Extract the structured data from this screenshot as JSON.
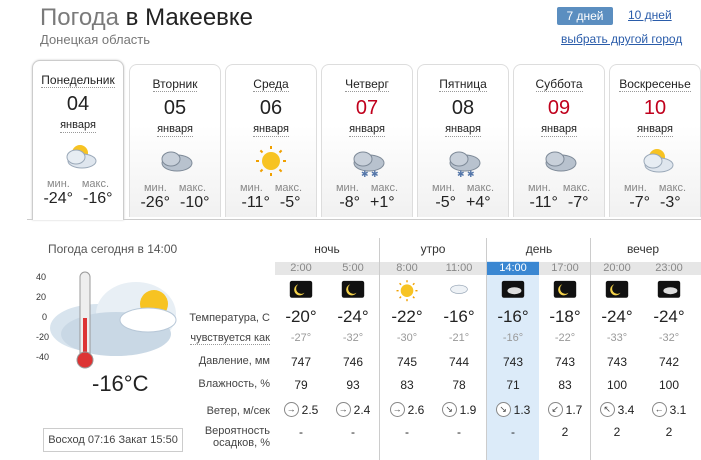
{
  "header": {
    "title_prefix": "Погода",
    "title_city": "в Макеевке",
    "region": "Донецкая область",
    "toggle_7": "7 дней",
    "toggle_10": "10 дней",
    "other_city": "выбрать другой город"
  },
  "days": [
    {
      "name": "Понедельник",
      "num": "04",
      "month": "января",
      "min": "-24°",
      "max": "-16°",
      "icon": "partly-cloudy-sun-icon",
      "holiday": false
    },
    {
      "name": "Вторник",
      "num": "05",
      "month": "января",
      "min": "-26°",
      "max": "-10°",
      "icon": "cloudy-icon",
      "holiday": false
    },
    {
      "name": "Среда",
      "num": "06",
      "month": "января",
      "min": "-11°",
      "max": "-5°",
      "icon": "sun-icon",
      "holiday": false
    },
    {
      "name": "Четверг",
      "num": "07",
      "month": "января",
      "min": "-8°",
      "max": "+1°",
      "icon": "snow-cloud-icon",
      "holiday": true
    },
    {
      "name": "Пятница",
      "num": "08",
      "month": "января",
      "min": "-5°",
      "max": "+4°",
      "icon": "snow-cloud-icon",
      "holiday": false
    },
    {
      "name": "Суббота",
      "num": "09",
      "month": "января",
      "min": "-11°",
      "max": "-7°",
      "icon": "cloudy-icon",
      "holiday": true
    },
    {
      "name": "Воскресенье",
      "num": "10",
      "month": "января",
      "min": "-7°",
      "max": "-3°",
      "icon": "partly-cloudy-sun-icon",
      "holiday": true
    }
  ],
  "day_labels": {
    "min": "мин.",
    "max": "макс."
  },
  "today": {
    "title": "Погода сегодня в 14:00",
    "temp": "-16°C",
    "scale": [
      "40",
      "20",
      "0",
      "-20",
      "-40"
    ],
    "sunrise_label": "Восход",
    "sunrise": "07:16",
    "sunset_label": "Закат",
    "sunset": "15:50"
  },
  "periods": [
    "ночь",
    "утро",
    "день",
    "вечер"
  ],
  "hours": [
    "2:00",
    "5:00",
    "8:00",
    "11:00",
    "14:00",
    "17:00",
    "20:00",
    "23:00"
  ],
  "hour_icons": [
    "moon-icon",
    "moon-icon",
    "sun-icon",
    "cloud-icon",
    "cloud-moon-icon",
    "moon-icon",
    "moon-icon",
    "cloud-moon-icon"
  ],
  "row_labels": {
    "temp": "Температура, С",
    "feel": "чувствуется как",
    "pressure": "Давление, мм",
    "humidity": "Влажность, %",
    "wind": "Ветер, м/сек",
    "precip1": "Вероятность",
    "precip2": "осадков, %"
  },
  "temp": [
    "-20°",
    "-24°",
    "-22°",
    "-16°",
    "-16°",
    "-18°",
    "-24°",
    "-24°"
  ],
  "feel": [
    "-27°",
    "-32°",
    "-30°",
    "-21°",
    "-16°",
    "-22°",
    "-33°",
    "-32°"
  ],
  "pressure": [
    "747",
    "746",
    "745",
    "744",
    "743",
    "743",
    "743",
    "742"
  ],
  "humidity": [
    "79",
    "93",
    "83",
    "78",
    "71",
    "83",
    "100",
    "100"
  ],
  "wind_dir": [
    "→",
    "→",
    "→",
    "↘",
    "↘",
    "↙",
    "↖",
    "←"
  ],
  "wind": [
    "2.5",
    "2.4",
    "2.6",
    "1.9",
    "1.3",
    "1.7",
    "3.4",
    "3.1"
  ],
  "precip": [
    "-",
    "-",
    "-",
    "-",
    "-",
    "2",
    "2",
    "2"
  ]
}
